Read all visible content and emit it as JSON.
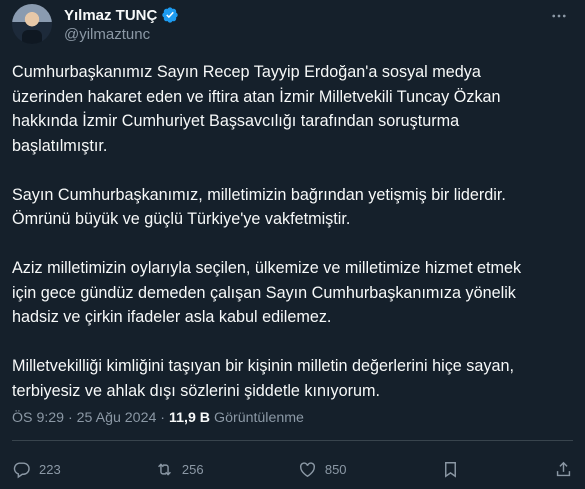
{
  "author": {
    "display_name": "Yılmaz TUNÇ",
    "handle": "@yilmaztunc",
    "verified": true
  },
  "tweet": {
    "paragraphs": [
      "Cumhurbaşkanımız Sayın Recep Tayyip Erdoğan'a sosyal medya\nüzerinden hakaret eden ve iftira atan İzmir Milletvekili Tuncay Özkan\nhakkında İzmir Cumhuriyet Başsavcılığı tarafından soruşturma\nbaşlatılmıştır.",
      "Sayın Cumhurbaşkanımız, milletimizin bağrından yetişmiş bir liderdir.\nÖmrünü büyük ve güçlü Türkiye'ye vakfetmiştir.",
      "Aziz milletimizin oylarıyla seçilen, ülkemize ve milletimize hizmet etmek\niçin gece gündüz demeden çalışan Sayın Cumhurbaşkanımıza yönelik\nhadsiz ve çirkin ifadeler asla kabul edilemez.",
      "Milletvekilliği kimliğini taşıyan bir kişinin milletin değerlerini hiçe sayan,\nterbiyesiz ve ahlak dışı sözlerini şiddetle kınıyorum."
    ],
    "timestamp": "ÖS 9:29 · 25 Ağu 2024 ·",
    "views_count": "11,9 B",
    "views_label": "Görüntülenme"
  },
  "actions": {
    "reply_count": "223",
    "repost_count": "256",
    "like_count": "850"
  },
  "colors": {
    "background": "#15202b",
    "text": "#f7f9f9",
    "secondary": "#8b98a5",
    "verified": "#1d9bf0",
    "divider": "#38444d"
  },
  "icons": [
    "more-icon",
    "verified-icon",
    "reply-icon",
    "repost-icon",
    "like-icon",
    "bookmark-icon",
    "share-icon"
  ]
}
